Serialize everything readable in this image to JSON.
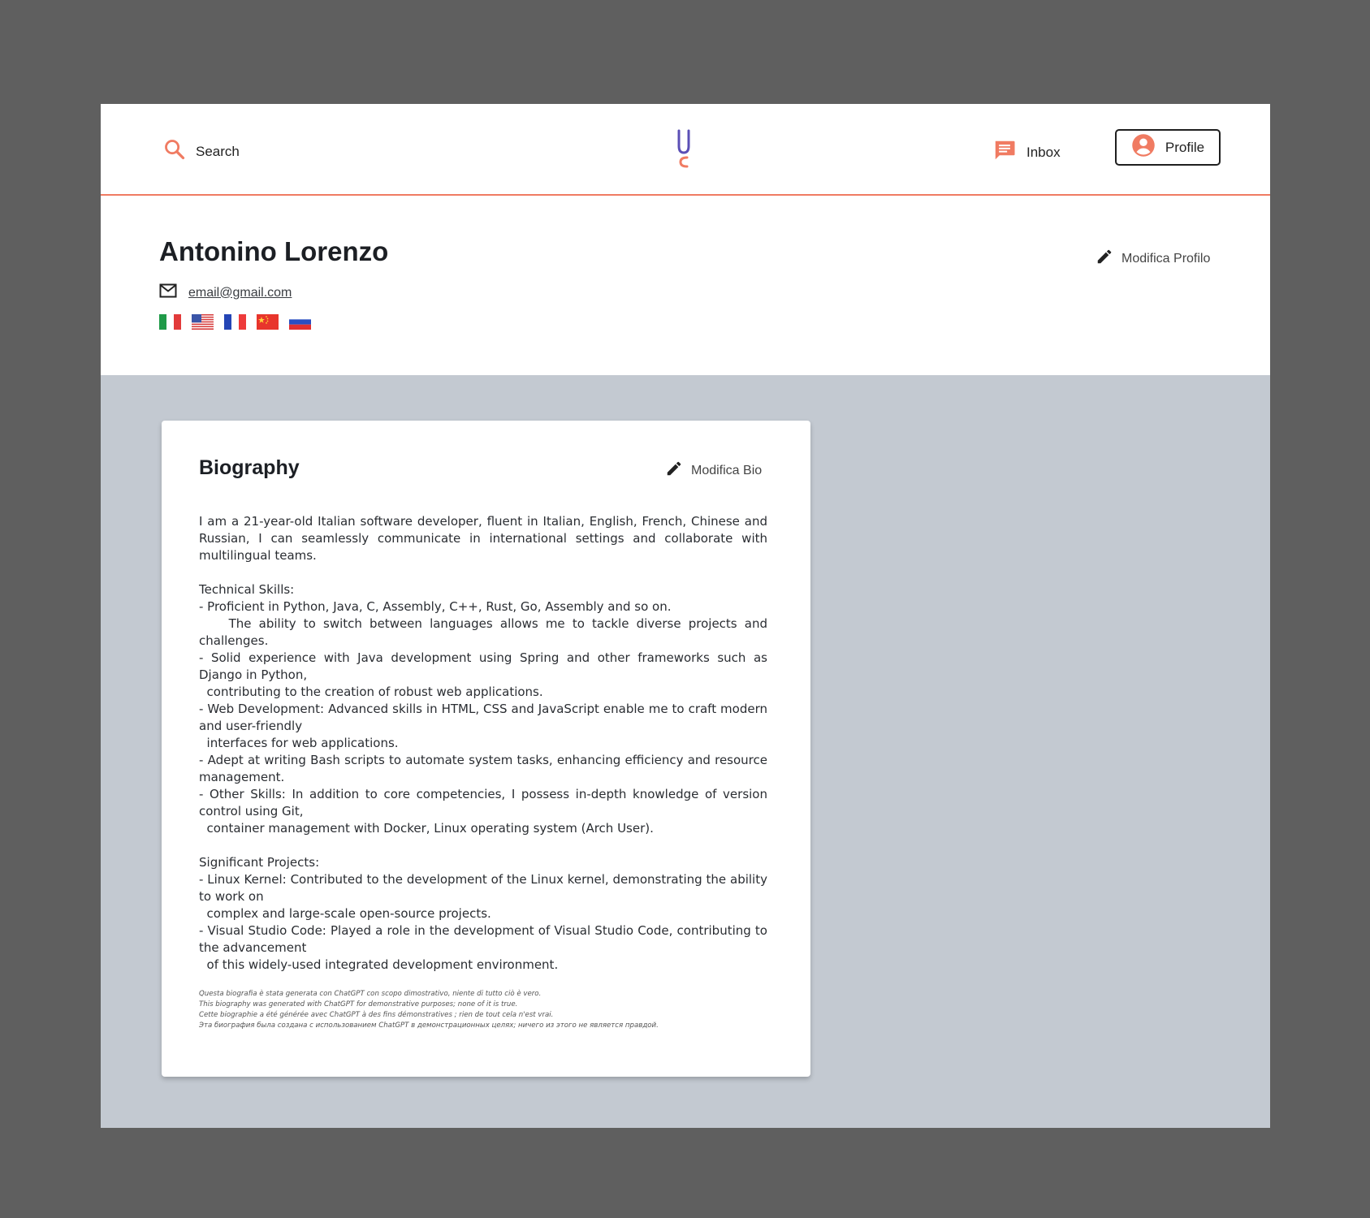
{
  "nav": {
    "search_label": "Search",
    "inbox_label": "Inbox",
    "profile_label": "Profile",
    "logo_icon": "u-c-logo-icon",
    "accent_color": "#f07b62",
    "logo_color": "#5b4fb6"
  },
  "profile": {
    "name": "Antonino Lorenzo",
    "email": "email@gmail.com",
    "edit_label": "Modifica Profilo",
    "languages": [
      "Italian",
      "English",
      "French",
      "Chinese",
      "Russian"
    ]
  },
  "biography": {
    "title": "Biography",
    "edit_label": "Modifica Bio",
    "text": "I am a 21-year-old Italian software developer, fluent in Italian, English, French, Chinese and Russian, I can seamlessly communicate in international settings and collaborate with multilingual teams.\n\nTechnical Skills:\n- Proficient in Python, Java, C, Assembly, C++, Rust, Go, Assembly and so on.\n    The ability to switch between languages allows me to tackle diverse projects and challenges.\n- Solid experience with Java development using Spring and other frameworks such as Django in Python,\n  contributing to the creation of robust web applications.\n- Web Development: Advanced skills in HTML, CSS and JavaScript enable me to craft modern and user-friendly\n  interfaces for web applications.\n- Adept at writing Bash scripts to automate system tasks, enhancing efficiency and resource management.\n- Other Skills: In addition to core competencies, I possess in-depth knowledge of version control using Git,\n  container management with Docker, Linux operating system (Arch User).\n\nSignificant Projects:\n- Linux Kernel: Contributed to the development of the Linux kernel, demonstrating the ability to work on\n  complex and large-scale open-source projects.\n- Visual Studio Code: Played a role in the development of Visual Studio Code, contributing to the advancement\n  of this widely-used integrated development environment.",
    "disclaimer": [
      "Questa biografia è stata generata con ChatGPT con scopo dimostrativo, niente di tutto ciò è vero.",
      "This biography was generated with ChatGPT for demonstrative purposes; none of it is true.",
      "Cette biographie a été générée avec ChatGPT à des fins démonstratives ; rien de tout cela n'est vrai.",
      "Эта биография была создана с использованием ChatGPT в демонстрационных целях; ничего из этого не является правдой."
    ]
  }
}
